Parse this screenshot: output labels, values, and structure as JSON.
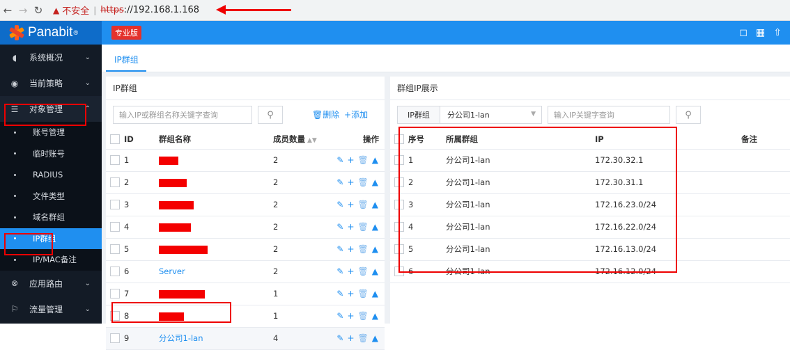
{
  "browser": {
    "warning_label": "不安全",
    "url_scheme": "https",
    "url_rest": "://192.168.1.168"
  },
  "header": {
    "brand": "Panabit",
    "brand_mark": "®",
    "edition": "专业版"
  },
  "sidebar": {
    "items": [
      {
        "label": "系统概况",
        "icon": "gauge-icon"
      },
      {
        "label": "当前策略",
        "icon": "location-pin-icon"
      },
      {
        "label": "对象管理",
        "icon": "database-icon"
      }
    ],
    "sub_items": [
      "账号管理",
      "临时账号",
      "RADIUS",
      "文件类型",
      "域名群组",
      "IP群组",
      "IP/MAC备注"
    ],
    "bottom_items": [
      {
        "label": "应用路由",
        "icon": "route-icon"
      },
      {
        "label": "流量管理",
        "icon": "flag-icon"
      }
    ]
  },
  "tabs": [
    {
      "label": "IP群组"
    }
  ],
  "left_panel": {
    "title": "IP群组",
    "search_placeholder": "输入IP或群组名称关键字查询",
    "delete_label": "删除",
    "add_label": "添加",
    "columns": [
      "ID",
      "群组名称",
      "成员数量",
      "操作"
    ],
    "rows": [
      {
        "id": "1",
        "name": "",
        "members": "2"
      },
      {
        "id": "2",
        "name": "",
        "members": "2"
      },
      {
        "id": "3",
        "name": "",
        "members": "2"
      },
      {
        "id": "4",
        "name": "",
        "members": "2"
      },
      {
        "id": "5",
        "name": "",
        "members": "2"
      },
      {
        "id": "6",
        "name": "Server",
        "members": "2"
      },
      {
        "id": "7",
        "name": "",
        "members": "1"
      },
      {
        "id": "8",
        "name": "",
        "members": "1"
      },
      {
        "id": "9",
        "name": "分公司1-lan",
        "members": "4"
      }
    ]
  },
  "right_panel": {
    "title": "群组IP展示",
    "filter_label": "IP群组",
    "selected_group": "分公司1-lan",
    "ip_placeholder": "输入IP关键字查询",
    "columns": [
      "序号",
      "所属群组",
      "IP",
      "备注"
    ],
    "rows": [
      {
        "no": "1",
        "group": "分公司1-lan",
        "ip": "172.30.32.1"
      },
      {
        "no": "2",
        "group": "分公司1-lan",
        "ip": "172.30.31.1"
      },
      {
        "no": "3",
        "group": "分公司1-lan",
        "ip": "172.16.23.0/24"
      },
      {
        "no": "4",
        "group": "分公司1-lan",
        "ip": "172.16.22.0/24"
      },
      {
        "no": "5",
        "group": "分公司1-lan",
        "ip": "172.16.13.0/24"
      },
      {
        "no": "6",
        "group": "分公司1-lan",
        "ip": "172.16.12.0/24"
      }
    ]
  }
}
